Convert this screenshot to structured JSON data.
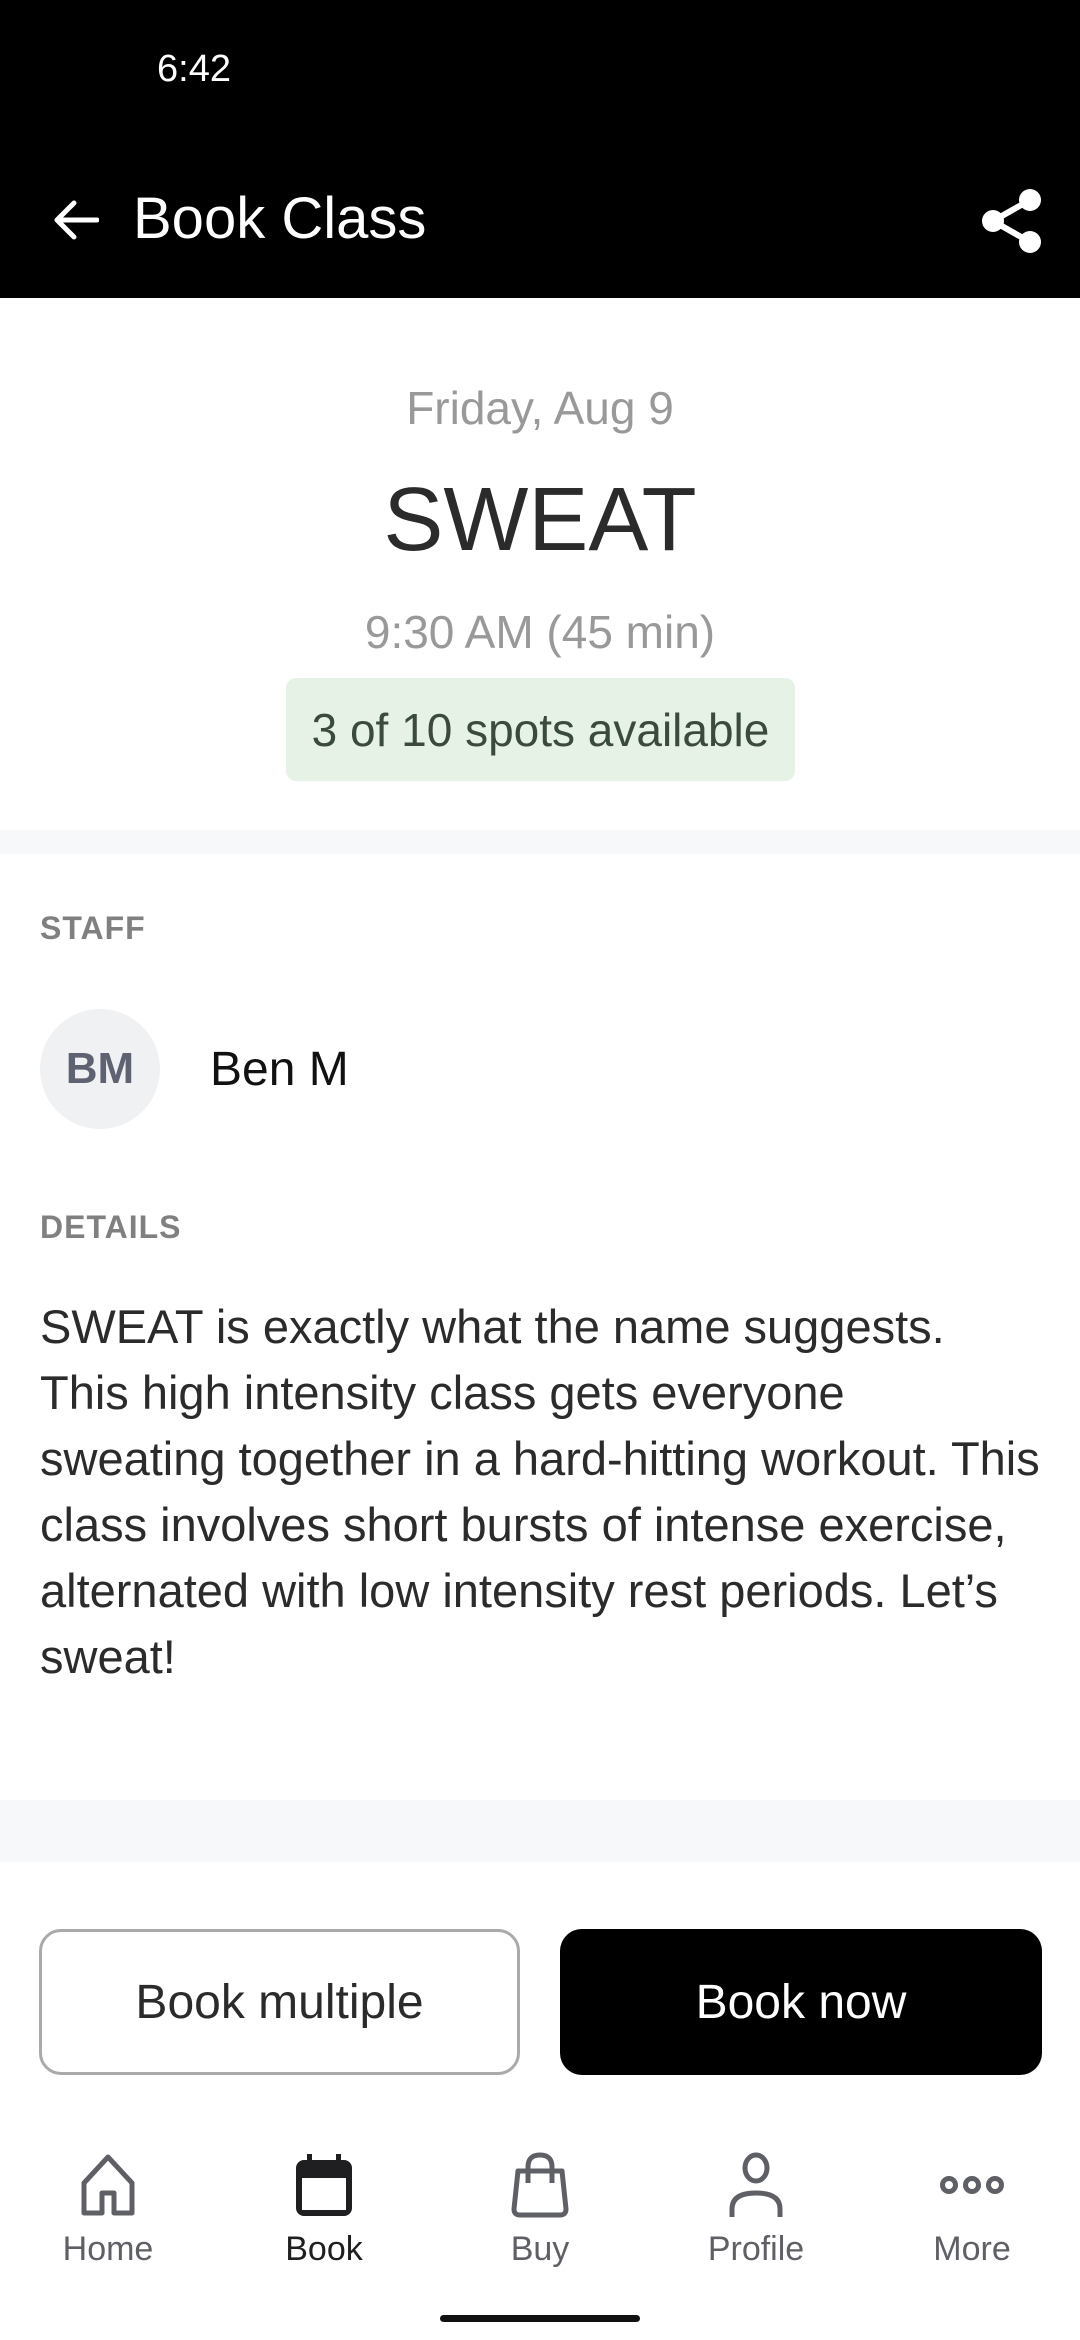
{
  "status_bar": {
    "time": "6:42"
  },
  "header": {
    "title": "Book Class",
    "back_icon": "arrow-left-icon",
    "share_icon": "share-icon"
  },
  "class_info": {
    "date": "Friday, Aug 9",
    "name": "SWEAT",
    "time": "9:30 AM (45 min)",
    "spots": "3 of 10 spots available"
  },
  "staff": {
    "section_label": "STAFF",
    "initials": "BM",
    "name": "Ben M"
  },
  "details": {
    "section_label": "DETAILS",
    "text": "SWEAT is exactly what the name suggests. This high intensity class gets everyone sweating together in a hard-hitting workout. This class involves short bursts of intense exercise, alternated with low intensity rest periods. Let’s sweat!"
  },
  "actions": {
    "book_multiple": "Book multiple",
    "book_now": "Book now"
  },
  "nav": {
    "items": [
      {
        "label": "Home",
        "icon": "home-icon",
        "active": false
      },
      {
        "label": "Book",
        "icon": "calendar-icon",
        "active": true
      },
      {
        "label": "Buy",
        "icon": "shopping-bag-icon",
        "active": false
      },
      {
        "label": "Profile",
        "icon": "person-icon",
        "active": false
      },
      {
        "label": "More",
        "icon": "more-dots-icon",
        "active": false
      }
    ]
  },
  "colors": {
    "header_bg": "#000000",
    "badge_bg": "#e5f2e5",
    "primary_button": "#000000",
    "muted_text": "#999999"
  }
}
